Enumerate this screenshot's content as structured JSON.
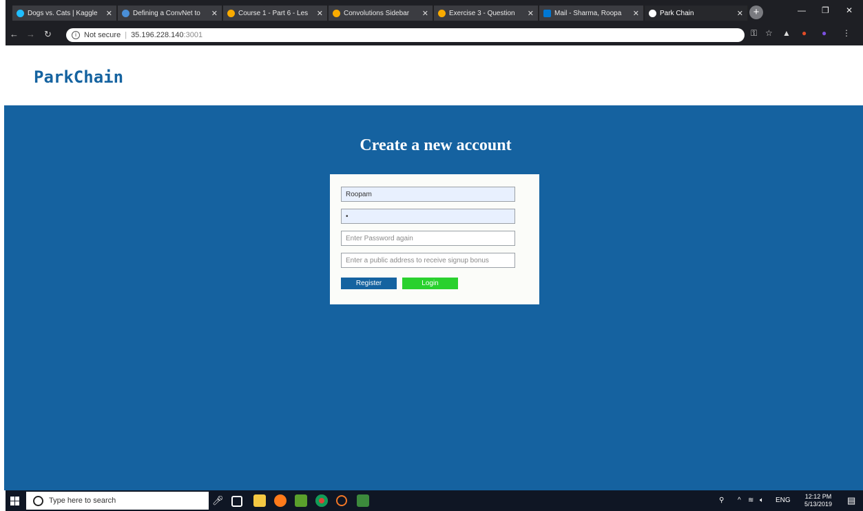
{
  "browser": {
    "tabs": [
      {
        "title": "Dogs vs. Cats | Kaggle",
        "favicon": "kaggle-icon",
        "color": "#20beff"
      },
      {
        "title": "Defining a ConvNet to",
        "favicon": "link-icon",
        "color": "#4a8fd8"
      },
      {
        "title": "Course 1 - Part 6 - Les",
        "favicon": "colab-icon",
        "color": "#f9ab00"
      },
      {
        "title": "Convolutions Sidebar",
        "favicon": "colab-icon",
        "color": "#f9ab00"
      },
      {
        "title": "Exercise 3 - Question",
        "favicon": "colab-icon",
        "color": "#f9ab00"
      },
      {
        "title": "Mail - Sharma, Roopa",
        "favicon": "outlook-icon",
        "color": "#0078d4"
      },
      {
        "title": "Park Chain",
        "favicon": "globe-icon",
        "color": "#ffffff"
      }
    ],
    "security_label": "Not secure",
    "url_host": "35.196.228.140",
    "url_port": ":3001"
  },
  "page": {
    "brand": "ParkChain",
    "heading": "Create a new account",
    "form": {
      "username_value": "Roopam",
      "password_value": "•",
      "confirm_placeholder": "Enter Password again",
      "address_placeholder": "Enter a public address to receive signup bonus",
      "register_label": "Register",
      "login_label": "Login"
    }
  },
  "taskbar": {
    "search_placeholder": "Type here to search",
    "language": "ENG",
    "time": "12:12 PM",
    "date": "5/13/2019"
  },
  "colors": {
    "brand": "#1563a0",
    "hero_bg": "#1562a0",
    "login_btn": "#2ad12e"
  }
}
